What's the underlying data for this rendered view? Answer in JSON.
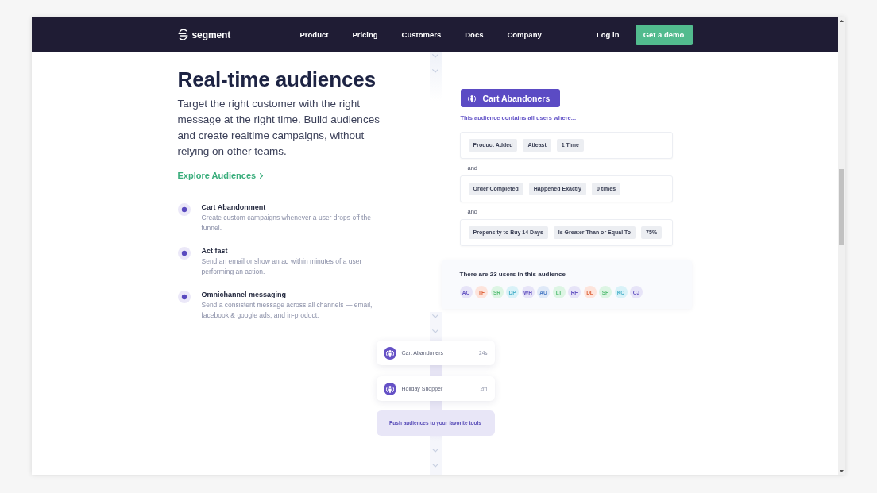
{
  "nav": {
    "logo_text": "segment",
    "links": [
      "Product",
      "Pricing",
      "Customers",
      "Docs",
      "Company"
    ],
    "login": "Log in",
    "cta": "Get a demo"
  },
  "hero": {
    "title": "Real-time audiences",
    "description": "Target the right customer with the right message at the right time. Build audiences and create realtime campaigns, without relying on other teams.",
    "link": "Explore Audiences"
  },
  "features": [
    {
      "title": "Cart Abandonment",
      "description": "Create custom campaigns whenever a user drops off the funnel."
    },
    {
      "title": "Act fast",
      "description": "Send an email or show an ad within minutes of a user performing an action."
    },
    {
      "title": "Omnichannel messaging",
      "description": "Send a consistent message across all channels — email, facebook & google ads, and in-product."
    }
  ],
  "audience": {
    "name": "Cart Abandoners",
    "subtitle": "This audience contains all users where...",
    "conditions": [
      {
        "chips": [
          "Product Added",
          "Atleast",
          "1 Time"
        ]
      },
      {
        "joiner": "and",
        "chips": [
          "Order Completed",
          "Happened Exactly",
          "0 times"
        ]
      },
      {
        "joiner": "and",
        "chips": [
          "Propensity to Buy 14 Days",
          "Is Greater Than or Equal To",
          "75%"
        ]
      }
    ],
    "users_summary": "There are 23 users in this audience",
    "users": [
      {
        "initials": "AC",
        "color": "#e7e4f8"
      },
      {
        "initials": "TF",
        "color": "#fde4dc"
      },
      {
        "initials": "SR",
        "color": "#ddf5e4"
      },
      {
        "initials": "DP",
        "color": "#d9f2f8"
      },
      {
        "initials": "WH",
        "color": "#e7e4f8"
      },
      {
        "initials": "AU",
        "color": "#dfe9f8"
      },
      {
        "initials": "LT",
        "color": "#ddf5e4"
      },
      {
        "initials": "RF",
        "color": "#e7e4f8"
      },
      {
        "initials": "DL",
        "color": "#fde4dc"
      },
      {
        "initials": "SP",
        "color": "#ddf5e4"
      },
      {
        "initials": "KO",
        "color": "#d9f2f8"
      },
      {
        "initials": "CJ",
        "color": "#e7e4f8"
      }
    ]
  },
  "destinations": [
    {
      "name": "Cart Abandoners",
      "time": "24s"
    },
    {
      "name": "Holiday Shopper",
      "time": "2m"
    }
  ],
  "push_label": "Push audiences to your favorite tools"
}
